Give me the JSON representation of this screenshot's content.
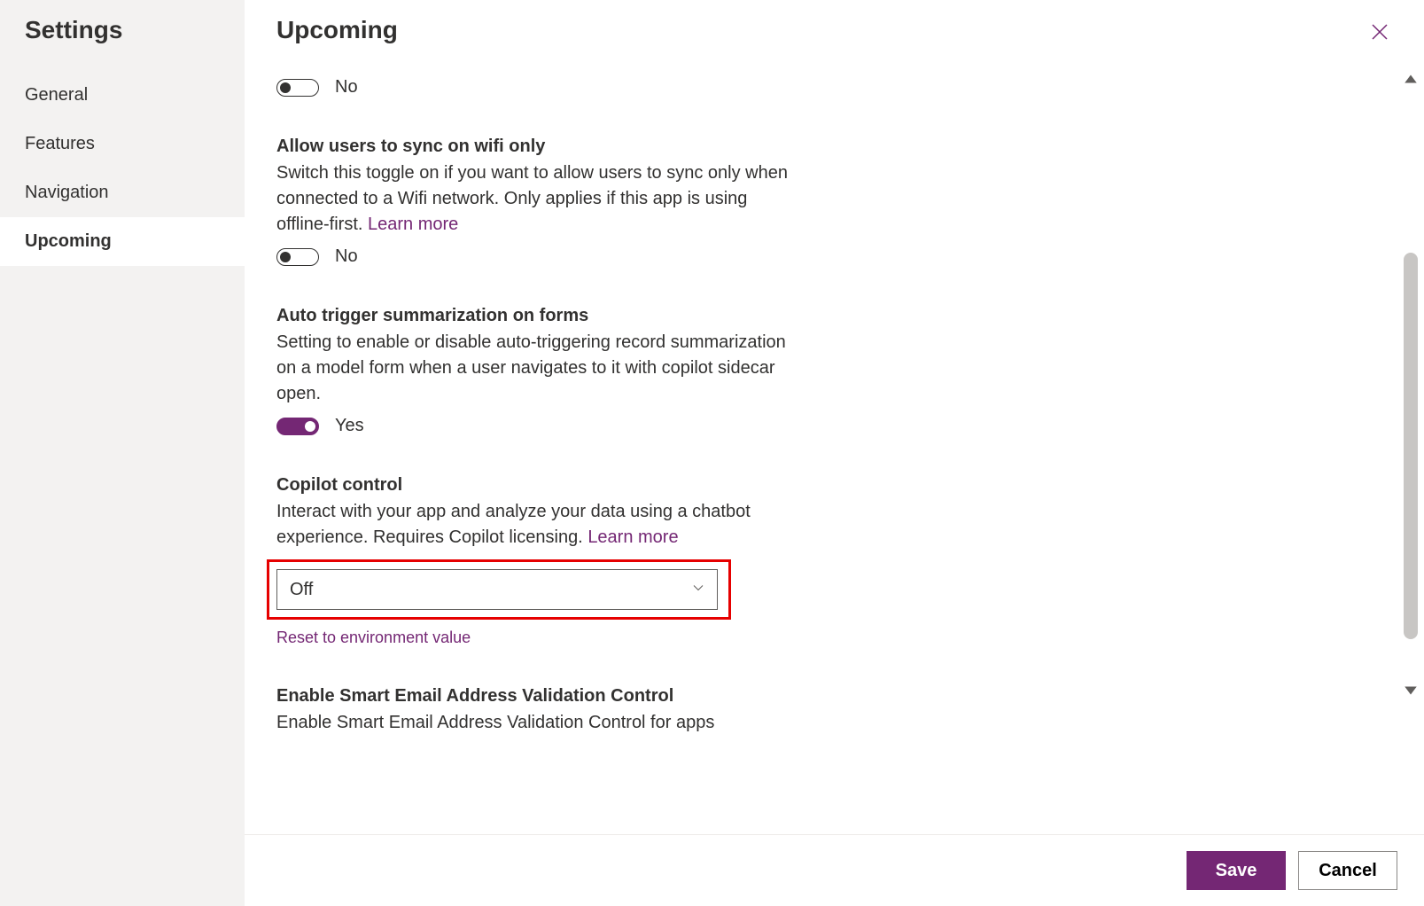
{
  "sidebar": {
    "title": "Settings",
    "items": [
      {
        "label": "General"
      },
      {
        "label": "Features"
      },
      {
        "label": "Navigation"
      },
      {
        "label": "Upcoming"
      }
    ],
    "active_index": 3
  },
  "header": {
    "title": "Upcoming"
  },
  "settings": {
    "orphan_toggle": {
      "state_label": "No"
    },
    "wifi_sync": {
      "title": "Allow users to sync on wifi only",
      "desc": "Switch this toggle on if you want to allow users to sync only when connected to a Wifi network. Only applies if this app is using offline-first. ",
      "learn_more": "Learn more",
      "state_label": "No"
    },
    "auto_summarize": {
      "title": "Auto trigger summarization on forms",
      "desc": "Setting to enable or disable auto-triggering record summarization on a model form when a user navigates to it with copilot sidecar open.",
      "state_label": "Yes"
    },
    "copilot": {
      "title": "Copilot control",
      "desc": "Interact with your app and analyze your data using a chatbot experience. Requires Copilot licensing. ",
      "learn_more": "Learn more",
      "selected": "Off",
      "reset_link": "Reset to environment value"
    },
    "smart_email": {
      "title": "Enable Smart Email Address Validation Control",
      "desc": "Enable Smart Email Address Validation Control for apps"
    }
  },
  "footer": {
    "save": "Save",
    "cancel": "Cancel"
  }
}
